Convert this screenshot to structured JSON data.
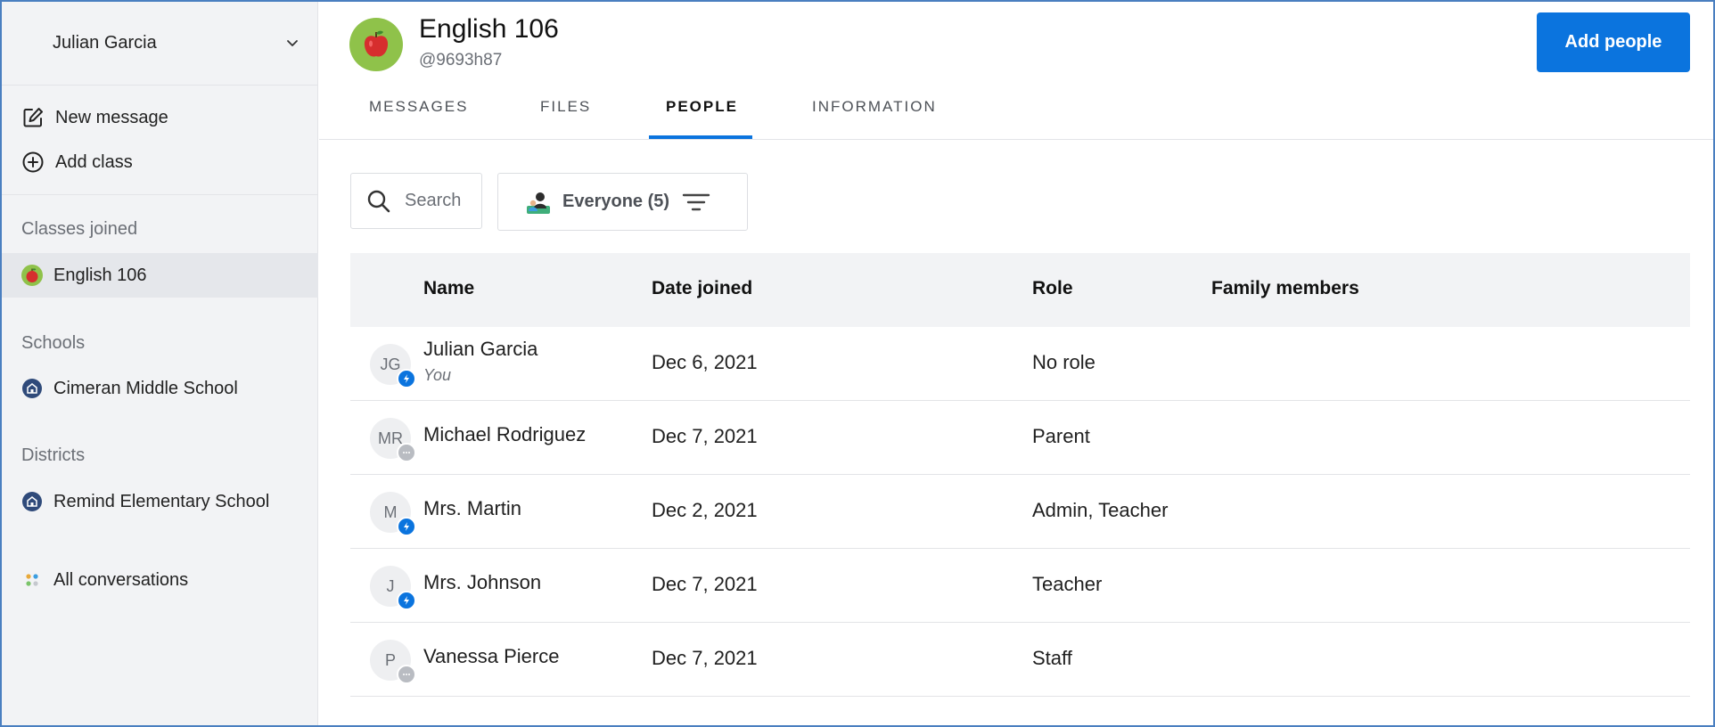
{
  "sidebar": {
    "user_name": "Julian Garcia",
    "actions": [
      {
        "label": "New message",
        "icon": "edit-icon"
      },
      {
        "label": "Add class",
        "icon": "plus-circle-icon"
      }
    ],
    "sections": {
      "classes_heading": "Classes joined",
      "classes": [
        {
          "label": "English 106",
          "icon": "apple-icon",
          "active": true
        }
      ],
      "schools_heading": "Schools",
      "schools": [
        {
          "label": "Cimeran Middle School",
          "icon": "school-icon"
        }
      ],
      "districts_heading": "Districts",
      "districts": [
        {
          "label": "Remind Elementary School",
          "icon": "school-icon"
        }
      ],
      "all_conversations": "All conversations"
    }
  },
  "header": {
    "class_title": "English 106",
    "class_code": "@9693h87",
    "add_people_label": "Add people",
    "tabs": [
      {
        "label": "MESSAGES",
        "active": false
      },
      {
        "label": "FILES",
        "active": false
      },
      {
        "label": "PEOPLE",
        "active": true
      },
      {
        "label": "INFORMATION",
        "active": false
      }
    ]
  },
  "toolbar": {
    "search_placeholder": "Search",
    "filter_label": "Everyone (5)"
  },
  "table": {
    "columns": [
      "Name",
      "Date joined",
      "Role",
      "Family members"
    ],
    "rows": [
      {
        "initials": "JG",
        "name": "Julian Garcia",
        "sub": "You",
        "date": "Dec 6, 2021",
        "role": "No role",
        "badge": "active"
      },
      {
        "initials": "MR",
        "name": "Michael Rodriguez",
        "sub": "",
        "date": "Dec 7, 2021",
        "role": "Parent",
        "badge": "pending"
      },
      {
        "initials": "M",
        "name": "Mrs. Martin",
        "sub": "",
        "date": "Dec 2, 2021",
        "role": "Admin, Teacher",
        "badge": "active"
      },
      {
        "initials": "J",
        "name": "Mrs. Johnson",
        "sub": "",
        "date": "Dec 7, 2021",
        "role": "Teacher",
        "badge": "active"
      },
      {
        "initials": "P",
        "name": "Vanessa Pierce",
        "sub": "",
        "date": "Dec 7, 2021",
        "role": "Staff",
        "badge": "pending"
      }
    ]
  },
  "colors": {
    "accent": "#0b74de",
    "sidebar_bg": "#f2f3f5",
    "apple_bg": "#8fc24a"
  }
}
